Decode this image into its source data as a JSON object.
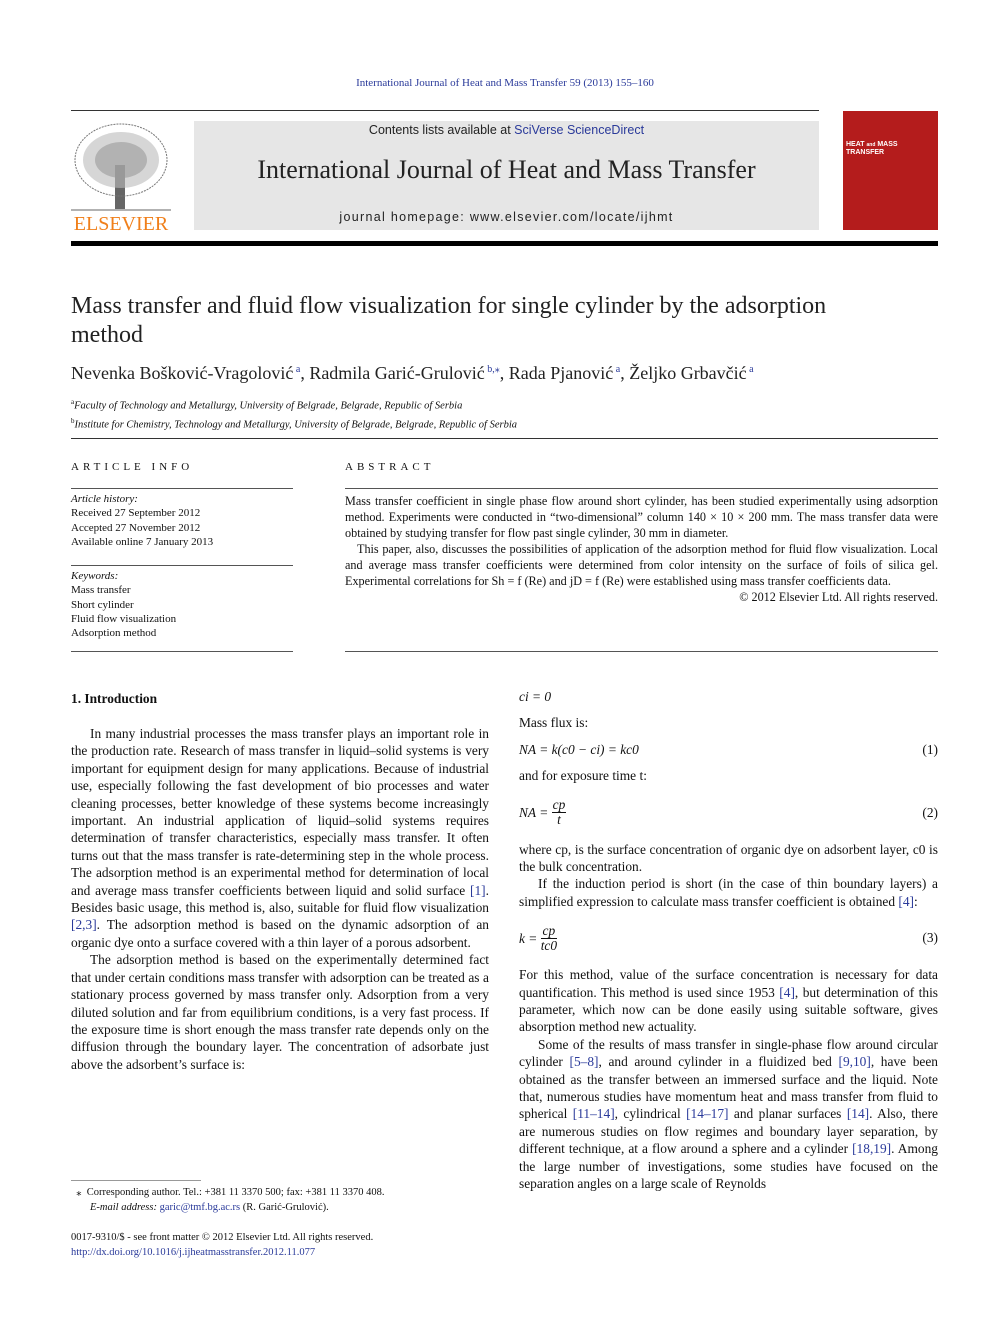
{
  "running_head": "International Journal of Heat and Mass Transfer 59 (2013) 155–160",
  "publisher": {
    "name": "ELSEVIER",
    "color": "#f07f1a"
  },
  "banner": {
    "contents_prefix": "Contents lists available at ",
    "contents_link": "SciVerse ScienceDirect",
    "journal_title": "International Journal of Heat and Mass Transfer",
    "homepage": "journal homepage: www.elsevier.com/locate/ijhmt"
  },
  "cover": {
    "text": "HEAT and MASS TRANSFER",
    "color": "#b41c1c"
  },
  "article": {
    "title": "Mass transfer and fluid flow visualization for single cylinder by the adsorption method",
    "authors": [
      {
        "name": "Nevenka Bošković-Vragolović",
        "sup": "a"
      },
      {
        "name": "Radmila Garić-Grulović",
        "sup": "b,⁎"
      },
      {
        "name": "Rada Pjanović",
        "sup": "a"
      },
      {
        "name": "Željko Grbavčić",
        "sup": "a"
      }
    ],
    "affiliations": [
      {
        "sup": "a",
        "text": "Faculty of Technology and Metallurgy, University of Belgrade, Belgrade, Republic of Serbia"
      },
      {
        "sup": "b",
        "text": "Institute for Chemistry, Technology and Metallurgy, University of Belgrade, Belgrade, Republic of Serbia"
      }
    ]
  },
  "article_info": {
    "heading": "ARTICLE INFO",
    "history_label": "Article history:",
    "history": [
      "Received 27 September 2012",
      "Accepted 27 November 2012",
      "Available online 7 January 2013"
    ],
    "keywords_label": "Keywords:",
    "keywords": [
      "Mass transfer",
      "Short cylinder",
      "Fluid flow visualization",
      "Adsorption method"
    ]
  },
  "abstract": {
    "heading": "ABSTRACT",
    "p1": "Mass transfer coefficient in single phase flow around short cylinder, has been studied experimentally using adsorption method. Experiments were conducted in “two-dimensional” column 140 × 10 × 200 mm. The mass transfer data were obtained by studying transfer for flow past single cylinder, 30 mm in diameter.",
    "p2": "This paper, also, discusses the possibilities of application of the adsorption method for fluid flow visualization. Local and average mass transfer coefficients were determined from color intensity on the surface of foils of silica gel. Experimental correlations for Sh = f (Re) and jD = f (Re) were established using mass transfer coefficients data.",
    "copyright": "© 2012 Elsevier Ltd. All rights reserved."
  },
  "intro": {
    "heading": "1. Introduction",
    "left_paragraphs": [
      [
        {
          "t": "In many industrial processes the mass transfer plays an important role in the production rate. Research of mass transfer in liquid–solid systems is very important for equipment design for many applications. Because of industrial use, especially following the fast development of bio processes and water cleaning processes, better knowledge of these systems become increasingly important. An industrial application of liquid–solid systems requires determination of transfer characteristics, especially mass transfer. It often turns out that the mass transfer is rate-determining step in the whole process. The adsorption method is an experimental method for determination of local and average mass transfer coefficients between liquid and solid surface "
        },
        {
          "t": "[1]",
          "l": 1
        },
        {
          "t": ". Besides basic usage, this method is, also, suitable for fluid flow visualization "
        },
        {
          "t": "[2,3]",
          "l": 1
        },
        {
          "t": ". The adsorption method is based on the dynamic adsorption of an organic dye onto a surface covered with a thin layer of a porous adsorbent."
        }
      ],
      [
        {
          "t": "The adsorption method is based on the experimentally determined fact that under certain conditions mass transfer with adsorption can be treated as a stationary process governed by mass transfer only. Adsorption from a very diluted solution and far from equilibrium conditions, is a very fast process. If the exposure time is short enough the mass transfer rate depends only on the diffusion through the boundary layer. The concentration of adsorbate just above the adsorbent’s surface is:"
        }
      ]
    ],
    "eq0": "ci = 0",
    "mass_flux": "Mass flux is:",
    "eq1": {
      "lhs": "NA = k(c0 − ci) = kc0",
      "num": "(1)"
    },
    "exposure": "and for exposure time t:",
    "eq2": {
      "lhs": "NA =",
      "numer": "cp",
      "denom": "t",
      "num": "(2)"
    },
    "right_p1": [
      {
        "t": "where cp, is the surface concentration of organic dye on adsorbent layer, c0 is the bulk concentration."
      }
    ],
    "right_p2": [
      {
        "t": "If the induction period is short (in the case of thin boundary layers) a simplified expression to calculate mass transfer coefficient is obtained "
      },
      {
        "t": "[4]",
        "l": 1
      },
      {
        "t": ":"
      }
    ],
    "eq3": {
      "lhs": "k =",
      "numer": "cp",
      "denom": "tc0",
      "num": "(3)"
    },
    "right_p3": [
      {
        "t": "For this method, value of the surface concentration is necessary for data quantification. This method is used since 1953 "
      },
      {
        "t": "[4]",
        "l": 1
      },
      {
        "t": ", but determination of this parameter, which now can be done easily using suitable software, gives absorption method new actuality."
      }
    ],
    "right_p4": [
      {
        "t": "Some of the results of mass transfer in single-phase flow around circular cylinder "
      },
      {
        "t": "[5–8]",
        "l": 1
      },
      {
        "t": ", and around cylinder in a fluidized bed "
      },
      {
        "t": "[9,10]",
        "l": 1
      },
      {
        "t": ", have been obtained as the transfer between an immersed surface and the liquid. Note that, numerous studies have momentum heat and mass transfer from fluid to spherical "
      },
      {
        "t": "[11–14]",
        "l": 1
      },
      {
        "t": ", cylindrical "
      },
      {
        "t": "[14–17]",
        "l": 1
      },
      {
        "t": " and planar surfaces "
      },
      {
        "t": "[14]",
        "l": 1
      },
      {
        "t": ". Also, there are numerous studies on flow regimes and boundary layer separation, by different technique, at a flow around a sphere and a cylinder "
      },
      {
        "t": "[18,19]",
        "l": 1
      },
      {
        "t": ". Among the large number of investigations, some studies have focused on the separation angles on a large scale of Reynolds"
      }
    ]
  },
  "footnote": {
    "mark": "⁎",
    "text": "Corresponding author. Tel.: +381 11 3370 500; fax: +381 11 3370 408.",
    "email_label": "E-mail address: ",
    "email": "garic@tmf.bg.ac.rs",
    "email_name": " (R. Garić-Grulović)."
  },
  "bottom": {
    "issn": "0017-9310/$ - see front matter © 2012 Elsevier Ltd. All rights reserved.",
    "doi": "http://dx.doi.org/10.1016/j.ijheatmasstransfer.2012.11.077"
  }
}
